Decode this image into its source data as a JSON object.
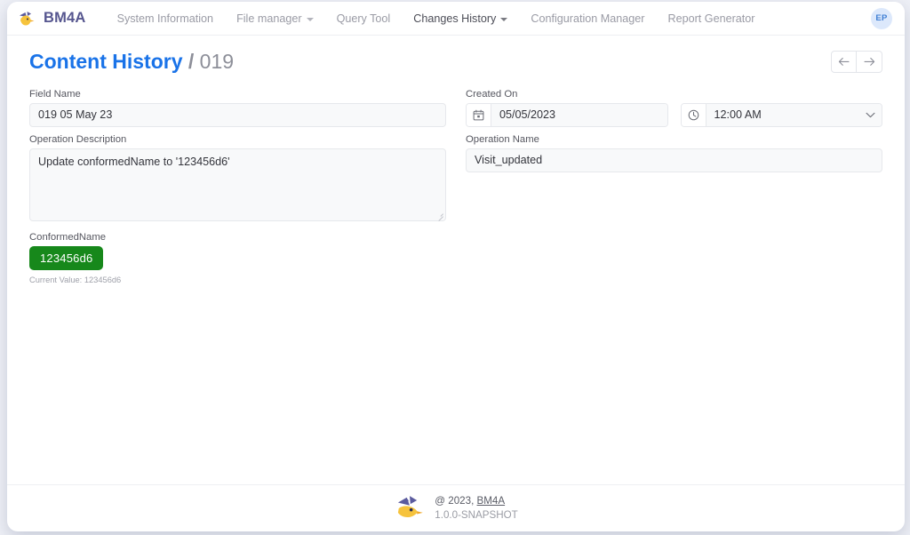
{
  "app": {
    "brand": "BM4A",
    "logo_icon": "bird-logo-icon"
  },
  "navbar": {
    "items": [
      {
        "label": "System Information",
        "has_caret": false,
        "active": false
      },
      {
        "label": "File manager",
        "has_caret": true,
        "active": false
      },
      {
        "label": "Query Tool",
        "has_caret": false,
        "active": false
      },
      {
        "label": "Changes History",
        "has_caret": true,
        "active": true
      },
      {
        "label": "Configuration Manager",
        "has_caret": false,
        "active": false
      },
      {
        "label": "Report Generator",
        "has_caret": false,
        "active": false
      }
    ],
    "avatar_initials": "EP"
  },
  "header": {
    "title_main": "Content History",
    "title_separator": "/",
    "title_sub": "019",
    "prev_button_icon": "arrow-left-icon",
    "next_button_icon": "arrow-right-icon"
  },
  "form": {
    "field_name": {
      "label": "Field Name",
      "value": "019 05 May 23"
    },
    "created_on": {
      "label": "Created On",
      "date_icon": "calendar-icon",
      "date_value": "05/05/2023",
      "time_icon": "clock-icon",
      "time_value": "12:00 AM",
      "time_caret_icon": "chevron-down-icon"
    },
    "operation_description": {
      "label": "Operation Description",
      "value": "Update conformedName to '123456d6'"
    },
    "operation_name": {
      "label": "Operation Name",
      "value": "Visit_updated"
    },
    "conformed_name": {
      "label": "ConformedName",
      "badge_value": "123456d6",
      "badge_color": "#17881b",
      "help_text": "Current Value: 123456d6"
    }
  },
  "footer": {
    "logo_icon": "puzzle-bird-logo-icon",
    "copyright_prefix": "@ 2023,",
    "copyright_brand": "BM4A",
    "version": "1.0.0-SNAPSHOT"
  },
  "theme": {
    "accent_blue": "#1a73e8",
    "brand_purple": "#56568f",
    "success_green": "#17881b"
  }
}
